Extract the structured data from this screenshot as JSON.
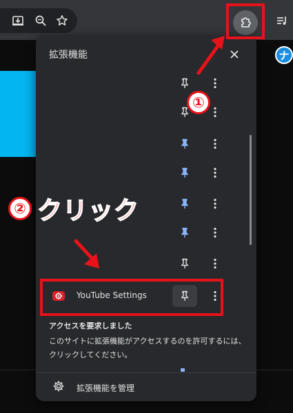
{
  "popup": {
    "title": "拡張機能",
    "highlighted_extension": {
      "name": "YouTube Settings"
    },
    "access_section": {
      "heading": "アクセスを要求しました",
      "text": "このサイトに拡張機能がアクセスするのを許可するには、クリックしてください。"
    },
    "manage_label": "拡張機能を管理"
  },
  "annotations": {
    "step1_badge": "①",
    "step2_badge": "②",
    "step2_label": "クリック"
  },
  "page": {
    "icon_glyph": "ナ"
  },
  "colors": {
    "accent_red": "#e8131a",
    "pin_blue": "#8ab4f8",
    "popup_bg": "#28292c",
    "toolbar_bg": "#35363a",
    "page_blue": "#03b5f0"
  },
  "icons": {
    "toolbar": [
      "install-icon",
      "zoom-icon",
      "bookmark-star-icon",
      "extensions-puzzle-icon",
      "media-queue-icon"
    ],
    "rows": [
      "pin-outline-icon",
      "pin-filled-icon",
      "more-vertical-icon",
      "youtube-settings-icon",
      "gear-icon",
      "close-icon"
    ]
  }
}
